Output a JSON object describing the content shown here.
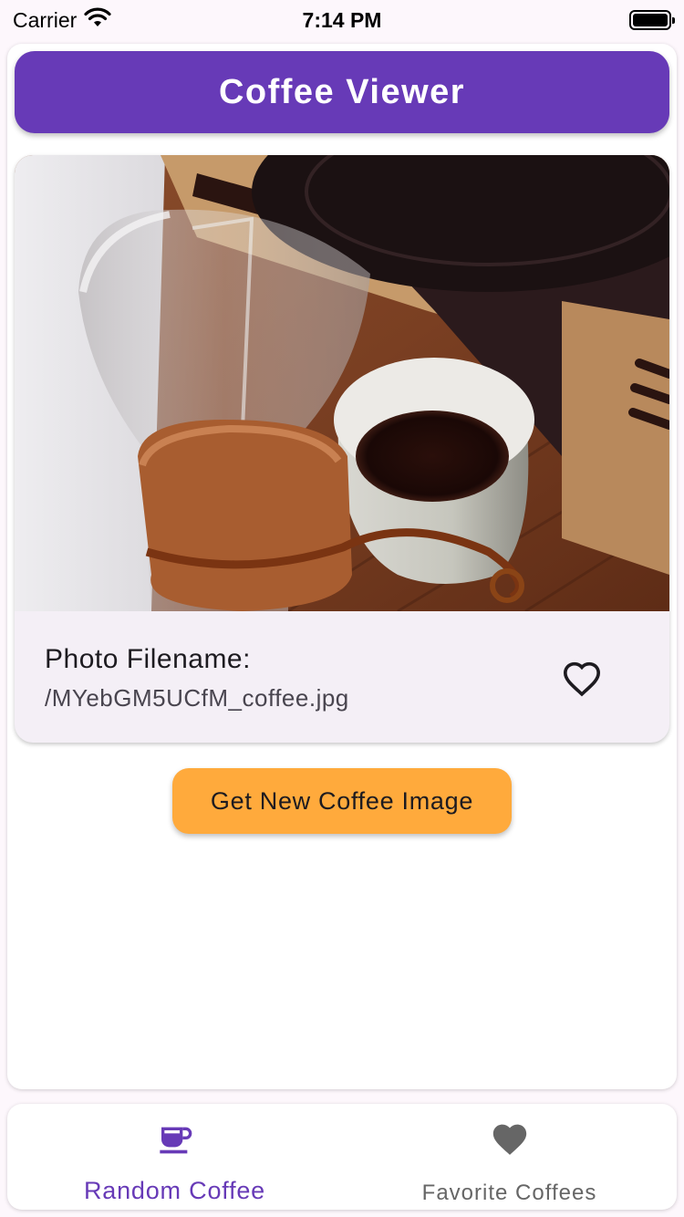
{
  "status_bar": {
    "carrier": "Carrier",
    "time": "7:14 PM",
    "icons": [
      "wifi-icon",
      "battery-icon"
    ]
  },
  "app_bar": {
    "title": "Coffee Viewer",
    "color": "#673ab7"
  },
  "photo_card": {
    "label": "Photo Filename:",
    "filename": "/MYebGM5UCfM_coffee.jpg",
    "image_subject": "Glass pour-over coffee maker with a wooden collar beside a white cup of black coffee on a wooden table",
    "favorite_icon": "heart-outline-icon",
    "favorited": false
  },
  "actions": {
    "new_image_label": "Get New Coffee Image",
    "button_color": "#ffaa3c"
  },
  "bottom_nav": {
    "items": [
      {
        "label": "Random Coffee",
        "icon": "coffee-cup-icon",
        "active": true
      },
      {
        "label": "Favorite Coffees",
        "icon": "heart-icon",
        "active": false
      }
    ],
    "active_color": "#673ab7",
    "inactive_color": "#666666"
  }
}
